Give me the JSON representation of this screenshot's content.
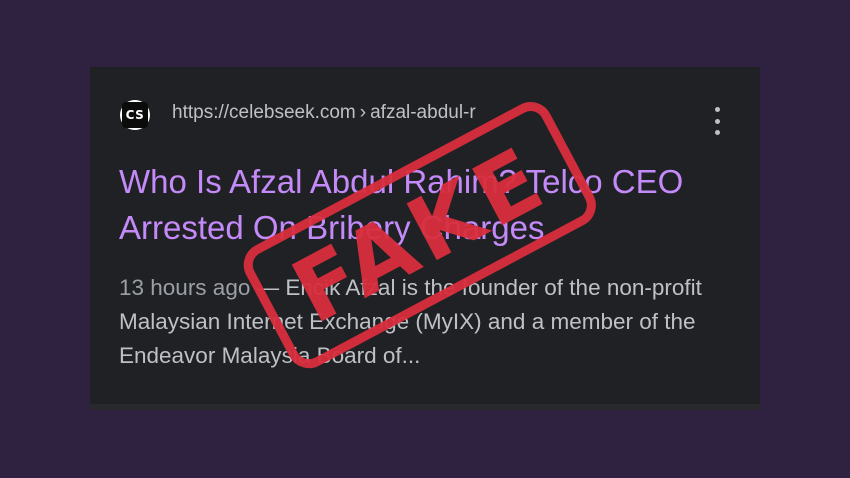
{
  "result": {
    "favicon_text": "CS",
    "url_base": "https://celebseek.com",
    "url_separator": "›",
    "url_path": "afzal-abdul-r",
    "menu_icon": "kebab-menu-icon",
    "title": "Who Is Afzal Abdul Rahim? Telco CEO Arrested On Bribery Charges",
    "snippet_age": "13 hours ago",
    "snippet_dash": "—",
    "snippet_text": "Encik Afzal is the founder of the non-profit Malaysian Internet Exchange (MyIX) and a member of the Endeavor Malaysia Board of..."
  },
  "stamp": {
    "text": "FAKE",
    "color": "#d92e3d"
  },
  "colors": {
    "background": "#2f2140",
    "card": "#202124",
    "title_link": "#c58af9",
    "text": "#bdc1c6"
  }
}
